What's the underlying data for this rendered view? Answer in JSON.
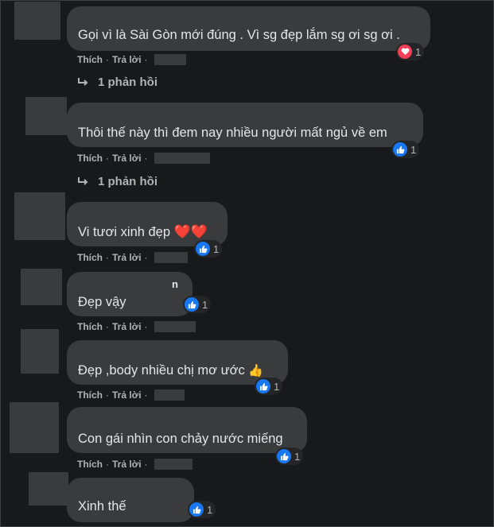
{
  "actions": {
    "like": "Thích",
    "reply": "Trả lời",
    "separator": "·"
  },
  "comments": [
    {
      "text": "Gọi vì là Sài Gòn mới đúng . Vì sg đẹp lắm sg ơi sg ơi .",
      "reaction": "love-icon",
      "count": "1",
      "replies": "1 phản hồi"
    },
    {
      "text": "Thôi thế này thì đem nay nhiều người mất ngủ về em",
      "reaction": "like-icon",
      "count": "1",
      "replies": "1 phản hồi"
    },
    {
      "text": "Vi tươi xinh đẹp",
      "emoji": "❤️❤️",
      "reaction": "like-icon",
      "count": "1"
    },
    {
      "name_fragment": "n",
      "text": "Đẹp vậy",
      "reaction": "like-icon",
      "count": "1"
    },
    {
      "text": "Đẹp ,body nhiều chị mơ ước",
      "emoji": "👍",
      "reaction": "like-icon",
      "count": "1"
    },
    {
      "text": "Con gái nhìn con chảy nước miếng",
      "reaction": "like-icon",
      "count": "1"
    },
    {
      "text": "Xinh thế",
      "reaction": "like-icon",
      "count": "1"
    }
  ],
  "colors": {
    "background": "#18191a",
    "bubble": "#3a3b3c",
    "like_blue": "#1877f2",
    "love_red": "#f33e58",
    "secondary_text": "#b0b3b8"
  }
}
